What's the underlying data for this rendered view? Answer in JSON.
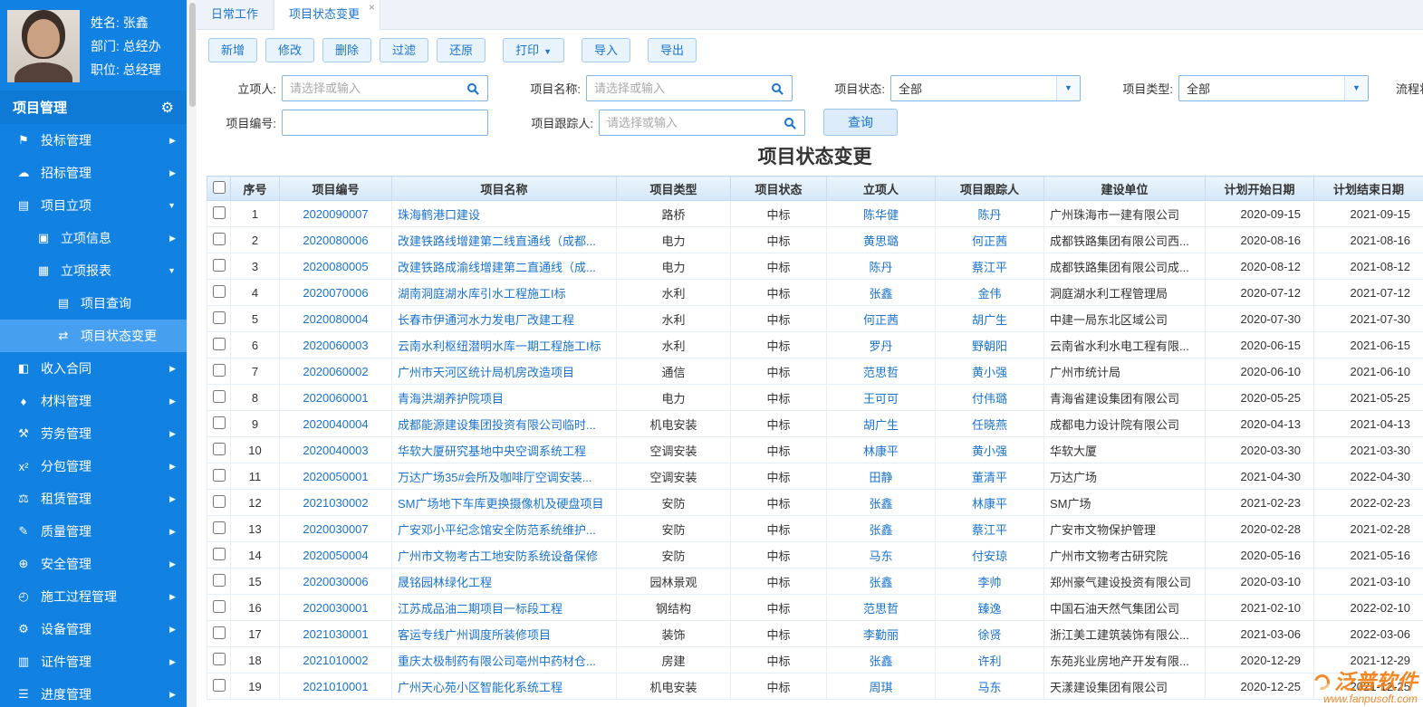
{
  "user": {
    "name": "姓名: 张鑫",
    "department": "部门: 总经办",
    "title": "职位: 总经理"
  },
  "sidebar": {
    "header": "项目管理",
    "items": [
      {
        "id": "bid",
        "label": "投标管理",
        "icon": "bid-icon",
        "glyph": "⚑",
        "level": 0,
        "chevron": "right"
      },
      {
        "id": "tender",
        "label": "招标管理",
        "icon": "tender-icon",
        "glyph": "☁",
        "level": 0,
        "chevron": "right"
      },
      {
        "id": "project-initiation",
        "label": "项目立项",
        "icon": "project-initiation-icon",
        "glyph": "▤",
        "level": 0,
        "chevron": "down"
      },
      {
        "id": "initiation-info",
        "label": "立项信息",
        "icon": "folder-icon",
        "glyph": "▣",
        "level": 1,
        "chevron": "right"
      },
      {
        "id": "initiation-report",
        "label": "立项报表",
        "icon": "folder-open-icon",
        "glyph": "▦",
        "level": 1,
        "chevron": "down"
      },
      {
        "id": "project-query",
        "label": "项目查询",
        "icon": "query-icon",
        "glyph": "▤",
        "level": 2
      },
      {
        "id": "project-status-change",
        "label": "项目状态变更",
        "icon": "status-change-icon",
        "glyph": "⇄",
        "level": 2,
        "active": true
      },
      {
        "id": "income-contract",
        "label": "收入合同",
        "icon": "income-contract-icon",
        "glyph": "◧",
        "level": 0,
        "chevron": "right"
      },
      {
        "id": "material",
        "label": "材料管理",
        "icon": "material-cart-icon",
        "glyph": "♦",
        "level": 0,
        "chevron": "right"
      },
      {
        "id": "labor",
        "label": "劳务管理",
        "icon": "labor-icon",
        "glyph": "⚒",
        "level": 0,
        "chevron": "right"
      },
      {
        "id": "subcontract",
        "label": "分包管理",
        "icon": "subcontract-icon",
        "glyph": "x²",
        "level": 0,
        "chevron": "right"
      },
      {
        "id": "lease",
        "label": "租赁管理",
        "icon": "lease-icon",
        "glyph": "⚖",
        "level": 0,
        "chevron": "right"
      },
      {
        "id": "quality",
        "label": "质量管理",
        "icon": "quality-edit-icon",
        "glyph": "✎",
        "level": 0,
        "chevron": "right"
      },
      {
        "id": "safety",
        "label": "安全管理",
        "icon": "safety-shield-icon",
        "glyph": "⊕",
        "level": 0,
        "chevron": "right"
      },
      {
        "id": "construction-process",
        "label": "施工过程管理",
        "icon": "process-clock-icon",
        "glyph": "◴",
        "level": 0,
        "chevron": "right"
      },
      {
        "id": "equipment",
        "label": "设备管理",
        "icon": "equipment-gear-icon",
        "glyph": "⚙",
        "level": 0,
        "chevron": "right"
      },
      {
        "id": "certificate",
        "label": "证件管理",
        "icon": "certificate-icon",
        "glyph": "▥",
        "level": 0,
        "chevron": "right"
      },
      {
        "id": "progress",
        "label": "进度管理",
        "icon": "progress-chart-icon",
        "glyph": "☰",
        "level": 0,
        "chevron": "right"
      }
    ]
  },
  "tabs": [
    {
      "label": "日常工作"
    },
    {
      "label": "项目状态变更"
    }
  ],
  "toolbar": [
    {
      "id": "add",
      "label": "新增"
    },
    {
      "id": "edit",
      "label": "修改"
    },
    {
      "id": "delete",
      "label": "删除"
    },
    {
      "id": "filter",
      "label": "过滤"
    },
    {
      "id": "restore",
      "label": "还原"
    },
    {
      "id": "print",
      "label": "打印",
      "caret": true,
      "gap": true
    },
    {
      "id": "import",
      "label": "导入",
      "gap": true
    },
    {
      "id": "export",
      "label": "导出",
      "gap": true
    }
  ],
  "filters": {
    "owner": {
      "label": "立项人:",
      "placeholder": "请选择或输入"
    },
    "project_name": {
      "label": "项目名称:",
      "placeholder": "请选择或输入"
    },
    "project_status": {
      "label": "项目状态:",
      "value": "全部"
    },
    "project_type": {
      "label": "项目类型:",
      "value": "全部"
    },
    "flow_status": {
      "label": "流程状态:"
    },
    "project_code": {
      "label": "项目编号:",
      "value": ""
    },
    "tracker": {
      "label": "项目跟踪人:",
      "placeholder": "请选择或输入"
    },
    "query_button": "查询"
  },
  "table": {
    "title": "项目状态变更",
    "columns": [
      "序号",
      "项目编号",
      "项目名称",
      "项目类型",
      "项目状态",
      "立项人",
      "项目跟踪人",
      "建设单位",
      "计划开始日期",
      "计划结束日期"
    ],
    "rows": [
      [
        "1",
        "2020090007",
        "珠海鹤港口建设",
        "路桥",
        "中标",
        "陈华健",
        "陈丹",
        "广州珠海市一建有限公司",
        "2020-09-15",
        "2021-09-15"
      ],
      [
        "2",
        "2020080006",
        "改建铁路线增建第二线直通线（成都...",
        "电力",
        "中标",
        "黄思璐",
        "何正茜",
        "成都铁路集团有限公司西...",
        "2020-08-16",
        "2021-08-16"
      ],
      [
        "3",
        "2020080005",
        "改建铁路成渝线增建第二直通线（成...",
        "电力",
        "中标",
        "陈丹",
        "蔡江平",
        "成都铁路集团有限公司成...",
        "2020-08-12",
        "2021-08-12"
      ],
      [
        "4",
        "2020070006",
        "湖南洞庭湖水库引水工程施工I标",
        "水利",
        "中标",
        "张鑫",
        "金伟",
        "洞庭湖水利工程管理局",
        "2020-07-12",
        "2021-07-12"
      ],
      [
        "5",
        "2020080004",
        "长春市伊通河水力发电厂改建工程",
        "水利",
        "中标",
        "何正茜",
        "胡广生",
        "中建一局东北区域公司",
        "2020-07-30",
        "2021-07-30"
      ],
      [
        "6",
        "2020060003",
        "云南水利枢纽潜明水库一期工程施工I标",
        "水利",
        "中标",
        "罗丹",
        "野朝阳",
        "云南省水利水电工程有限...",
        "2020-06-15",
        "2021-06-15"
      ],
      [
        "7",
        "2020060002",
        "广州市天河区统计局机房改造项目",
        "通信",
        "中标",
        "范思哲",
        "黄小强",
        "广州市统计局",
        "2020-06-10",
        "2021-06-10"
      ],
      [
        "8",
        "2020060001",
        "青海洪湖养护院项目",
        "电力",
        "中标",
        "王可可",
        "付伟璐",
        "青海省建设集团有限公司",
        "2020-05-25",
        "2021-05-25"
      ],
      [
        "9",
        "2020040004",
        "成都能源建设集团投资有限公司临时...",
        "机电安装",
        "中标",
        "胡广生",
        "任晓燕",
        "成都电力设计院有限公司",
        "2020-04-13",
        "2021-04-13"
      ],
      [
        "10",
        "2020040003",
        "华软大厦研究基地中央空调系统工程",
        "空调安装",
        "中标",
        "林康平",
        "黄小强",
        "华软大厦",
        "2020-03-30",
        "2021-03-30"
      ],
      [
        "11",
        "2020050001",
        "万达广场35#会所及咖啡厅空调安装...",
        "空调安装",
        "中标",
        "田静",
        "董清平",
        "万达广场",
        "2021-04-30",
        "2022-04-30"
      ],
      [
        "12",
        "2021030002",
        "SM广场地下车库更换摄像机及硬盘项目",
        "安防",
        "中标",
        "张鑫",
        "林康平",
        "SM广场",
        "2021-02-23",
        "2022-02-23"
      ],
      [
        "13",
        "2020030007",
        "广安邓小平纪念馆安全防范系统维护...",
        "安防",
        "中标",
        "张鑫",
        "蔡江平",
        "广安市文物保护管理",
        "2020-02-28",
        "2021-02-28"
      ],
      [
        "14",
        "2020050004",
        "广州市文物考古工地安防系统设备保修",
        "安防",
        "中标",
        "马东",
        "付安琼",
        "广州市文物考古研究院",
        "2020-05-16",
        "2021-05-16"
      ],
      [
        "15",
        "2020030006",
        "晟铭园林绿化工程",
        "园林景观",
        "中标",
        "张鑫",
        "李帅",
        "郑州豪气建设投资有限公司",
        "2020-03-10",
        "2021-03-10"
      ],
      [
        "16",
        "2020030001",
        "江苏成品油二期项目一标段工程",
        "钢结构",
        "中标",
        "范思哲",
        "臻逸",
        "中国石油天然气集团公司",
        "2021-02-10",
        "2022-02-10"
      ],
      [
        "17",
        "2021030001",
        "客运专线广州调度所装修项目",
        "装饰",
        "中标",
        "李勤丽",
        "徐贤",
        "浙江美工建筑装饰有限公...",
        "2021-03-06",
        "2022-03-06"
      ],
      [
        "18",
        "2021010002",
        "重庆太极制药有限公司亳州中药材仓...",
        "房建",
        "中标",
        "张鑫",
        "许利",
        "东苑兆业房地产开发有限...",
        "2020-12-29",
        "2021-12-29"
      ],
      [
        "19",
        "2021010001",
        "广州天心苑小区智能化系统工程",
        "机电安装",
        "中标",
        "周琪",
        "马东",
        "天漾建设集团有限公司",
        "2020-12-25",
        "2021-12-25"
      ]
    ]
  },
  "watermark": {
    "brand": "泛普软件",
    "url": "www.fanpusoft.com"
  }
}
